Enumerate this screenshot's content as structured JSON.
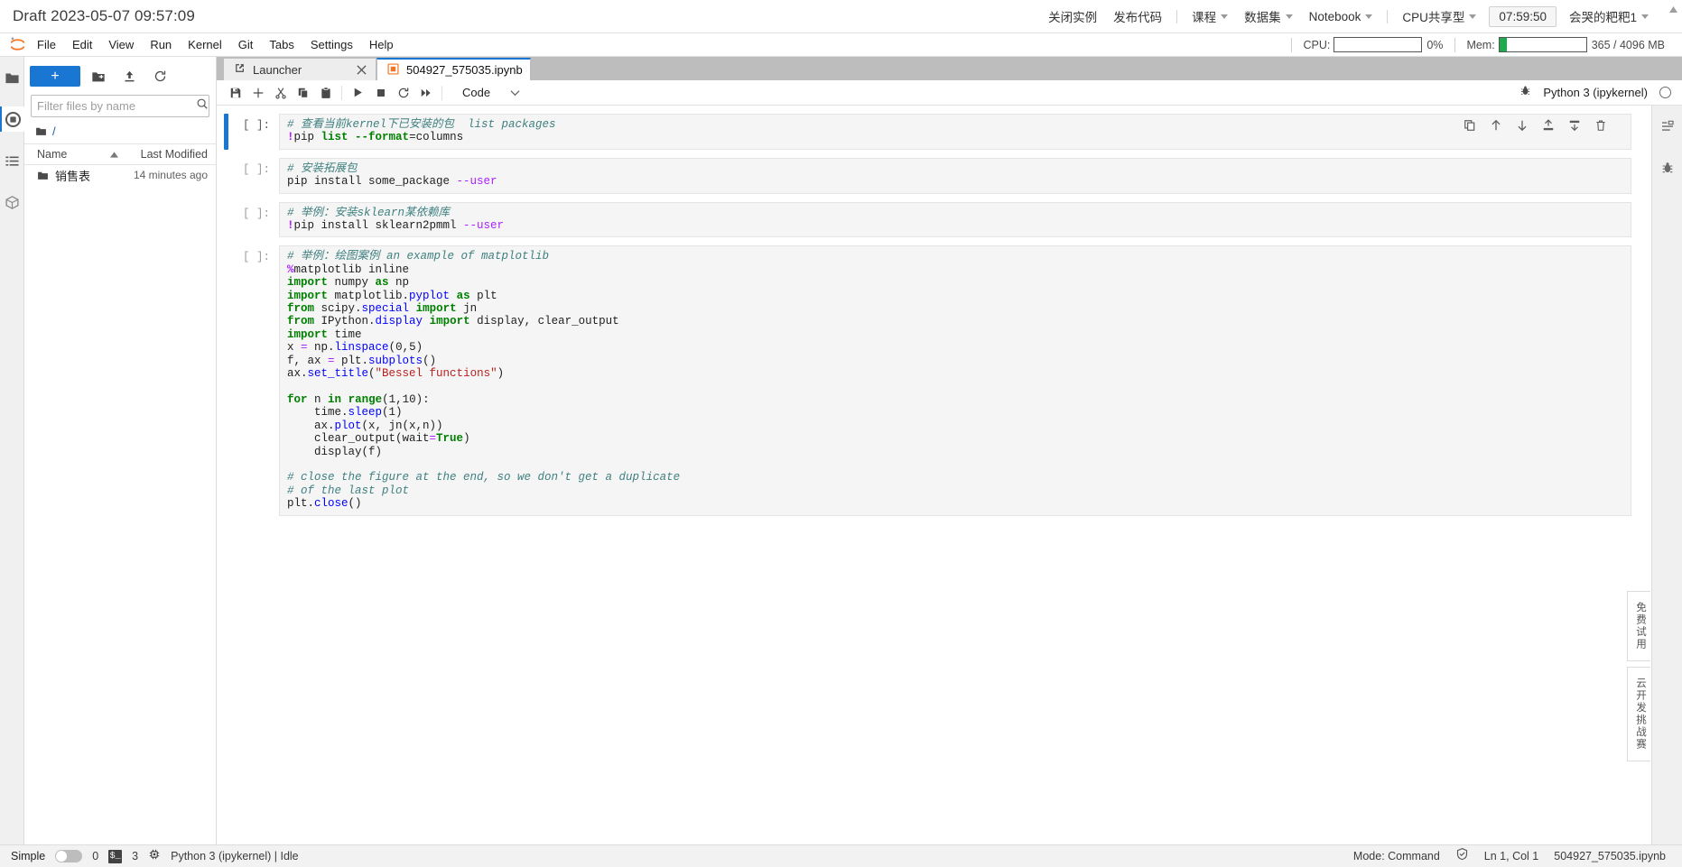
{
  "topbar": {
    "title": "Draft 2023-05-07 09:57:09",
    "actions": [
      {
        "label": "关闭实例",
        "caret": false
      },
      {
        "label": "发布代码",
        "caret": false
      }
    ],
    "menus": [
      {
        "label": "课程",
        "caret": true
      },
      {
        "label": "数据集",
        "caret": true
      },
      {
        "label": "Notebook",
        "caret": true
      }
    ],
    "spec": {
      "label": "CPU共享型",
      "caret": true
    },
    "timer": "07:59:50",
    "user": {
      "label": "会哭的粑粑1",
      "caret": true
    }
  },
  "menubar": {
    "logo": "jupyter-logo",
    "items": [
      "File",
      "Edit",
      "View",
      "Run",
      "Kernel",
      "Git",
      "Tabs",
      "Settings",
      "Help"
    ],
    "cpu": {
      "label": "CPU:",
      "value": "0%",
      "percent": 0,
      "color": "#2e9e4f"
    },
    "mem": {
      "label": "Mem:",
      "value": "365 / 4096 MB",
      "percent": 9,
      "color": "#1faa4b"
    }
  },
  "rail": {
    "items": [
      {
        "name": "file-browser-icon",
        "active": true
      },
      {
        "name": "running-terminals-icon",
        "active": false
      },
      {
        "name": "table-of-contents-icon",
        "active": false
      },
      {
        "name": "extension-manager-icon",
        "active": false
      }
    ]
  },
  "filebrowser": {
    "new_button_label": "+",
    "toolbar_icons": [
      "new-folder-icon",
      "upload-icon",
      "refresh-icon"
    ],
    "filter_placeholder": "Filter files by name",
    "filter_value": "",
    "breadcrumb": "/",
    "columns": {
      "name": "Name",
      "modified": "Last Modified"
    },
    "sort": "ascending",
    "rows": [
      {
        "name": "销售表",
        "modified": "14 minutes ago",
        "type": "folder"
      }
    ]
  },
  "tabs": [
    {
      "label": "Launcher",
      "icon": "launcher-icon",
      "active": false,
      "closable": true
    },
    {
      "label": "504927_575035.ipynb",
      "icon": "notebook-icon",
      "active": true,
      "closable": false
    }
  ],
  "notebook_toolbar": {
    "buttons": [
      "save-icon",
      "insert-cell-icon",
      "cut-icon",
      "copy-icon",
      "paste-icon",
      "run-icon",
      "stop-icon",
      "restart-icon",
      "restart-run-all-icon"
    ],
    "cell_type": "Code",
    "kernel_name": "Python 3 (ipykernel)",
    "kernel_status": "idle",
    "debug_icon": "bug-icon"
  },
  "cell_actions": [
    "duplicate-icon",
    "move-up-icon",
    "move-down-icon",
    "insert-above-icon",
    "insert-below-icon",
    "delete-icon"
  ],
  "cells": [
    {
      "prompt": "[ ]:",
      "selected": true,
      "lines": [
        [
          {
            "t": "# 查看当前kernel下已安装的包  list packages",
            "c": "cm"
          }
        ],
        [
          {
            "t": "!",
            "c": "mg"
          },
          {
            "t": "pip ",
            "c": "nb"
          },
          {
            "t": "list ",
            "c": "k"
          },
          {
            "t": "--format",
            "c": "k"
          },
          {
            "t": "=columns",
            "c": "nb"
          }
        ]
      ]
    },
    {
      "prompt": "[ ]:",
      "selected": false,
      "lines": [
        [
          {
            "t": "# 安装拓展包",
            "c": "cm"
          }
        ],
        [
          {
            "t": "pip install some_package ",
            "c": "nb"
          },
          {
            "t": "--user",
            "c": "op"
          }
        ]
      ]
    },
    {
      "prompt": "[ ]:",
      "selected": false,
      "lines": [
        [
          {
            "t": "# 举例：安装sklearn某依赖库",
            "c": "cm"
          }
        ],
        [
          {
            "t": "!",
            "c": "mg"
          },
          {
            "t": "pip install sklearn2pmml ",
            "c": "nb"
          },
          {
            "t": "--user",
            "c": "op"
          }
        ]
      ]
    },
    {
      "prompt": "[ ]:",
      "selected": false,
      "lines": [
        [
          {
            "t": "# 举例：绘图案例 an example of matplotlib",
            "c": "cm"
          }
        ],
        [
          {
            "t": "%",
            "c": "mg"
          },
          {
            "t": "matplotlib inline",
            "c": "nb"
          }
        ],
        [
          {
            "t": "import",
            "c": "k"
          },
          {
            "t": " numpy ",
            "c": "nb"
          },
          {
            "t": "as",
            "c": "k"
          },
          {
            "t": " np",
            "c": "nb"
          }
        ],
        [
          {
            "t": "import",
            "c": "k"
          },
          {
            "t": " matplotlib.",
            "c": "nb"
          },
          {
            "t": "pyplot",
            "c": "nf"
          },
          {
            "t": " ",
            "c": "nb"
          },
          {
            "t": "as",
            "c": "k"
          },
          {
            "t": " plt",
            "c": "nb"
          }
        ],
        [
          {
            "t": "from",
            "c": "k"
          },
          {
            "t": " scipy.",
            "c": "nb"
          },
          {
            "t": "special",
            "c": "nf"
          },
          {
            "t": " ",
            "c": "nb"
          },
          {
            "t": "import",
            "c": "k"
          },
          {
            "t": " jn",
            "c": "nb"
          }
        ],
        [
          {
            "t": "from",
            "c": "k"
          },
          {
            "t": " IPython.",
            "c": "nb"
          },
          {
            "t": "display",
            "c": "nf"
          },
          {
            "t": " ",
            "c": "nb"
          },
          {
            "t": "import",
            "c": "k"
          },
          {
            "t": " display, clear_output",
            "c": "nb"
          }
        ],
        [
          {
            "t": "import",
            "c": "k"
          },
          {
            "t": " time",
            "c": "nb"
          }
        ],
        [
          {
            "t": "x ",
            "c": "nb"
          },
          {
            "t": "=",
            "c": "op"
          },
          {
            "t": " np.",
            "c": "nb"
          },
          {
            "t": "linspace",
            "c": "nf"
          },
          {
            "t": "(0,5)",
            "c": "nb"
          }
        ],
        [
          {
            "t": "f, ax ",
            "c": "nb"
          },
          {
            "t": "=",
            "c": "op"
          },
          {
            "t": " plt.",
            "c": "nb"
          },
          {
            "t": "subplots",
            "c": "nf"
          },
          {
            "t": "()",
            "c": "nb"
          }
        ],
        [
          {
            "t": "ax.",
            "c": "nb"
          },
          {
            "t": "set_title",
            "c": "nf"
          },
          {
            "t": "(",
            "c": "nb"
          },
          {
            "t": "\"Bessel functions\"",
            "c": "st"
          },
          {
            "t": ")",
            "c": "nb"
          }
        ],
        [
          {
            "t": "",
            "c": "nb"
          }
        ],
        [
          {
            "t": "for",
            "c": "k"
          },
          {
            "t": " n ",
            "c": "nb"
          },
          {
            "t": "in",
            "c": "k"
          },
          {
            "t": " ",
            "c": "nb"
          },
          {
            "t": "range",
            "c": "k"
          },
          {
            "t": "(1,10):",
            "c": "nb"
          }
        ],
        [
          {
            "t": "    time.",
            "c": "nb"
          },
          {
            "t": "sleep",
            "c": "nf"
          },
          {
            "t": "(1)",
            "c": "nb"
          }
        ],
        [
          {
            "t": "    ax.",
            "c": "nb"
          },
          {
            "t": "plot",
            "c": "nf"
          },
          {
            "t": "(x, jn(x,n))",
            "c": "nb"
          }
        ],
        [
          {
            "t": "    clear_output(wait",
            "c": "nb"
          },
          {
            "t": "=",
            "c": "op"
          },
          {
            "t": "True",
            "c": "bi"
          },
          {
            "t": ")",
            "c": "nb"
          }
        ],
        [
          {
            "t": "    display(f)",
            "c": "nb"
          }
        ],
        [
          {
            "t": "",
            "c": "nb"
          }
        ],
        [
          {
            "t": "# close the figure at the end, so we don't get a duplicate",
            "c": "cm"
          }
        ],
        [
          {
            "t": "# of the last plot",
            "c": "cm"
          }
        ],
        [
          {
            "t": "plt.",
            "c": "nb"
          },
          {
            "t": "close",
            "c": "nf"
          },
          {
            "t": "()",
            "c": "nb"
          }
        ]
      ]
    }
  ],
  "promo": {
    "tab1": "免费试用",
    "tab2": "云开发挑战赛"
  },
  "statusbar": {
    "simple_label": "Simple",
    "simple_on": false,
    "kernel_count": "0",
    "terminal_badge": "$_",
    "terminal_count": "3",
    "kernel_status": "Python 3 (ipykernel) | Idle",
    "mode": "Mode: Command",
    "position": "Ln 1, Col 1",
    "filename": "504927_575035.ipynb"
  }
}
